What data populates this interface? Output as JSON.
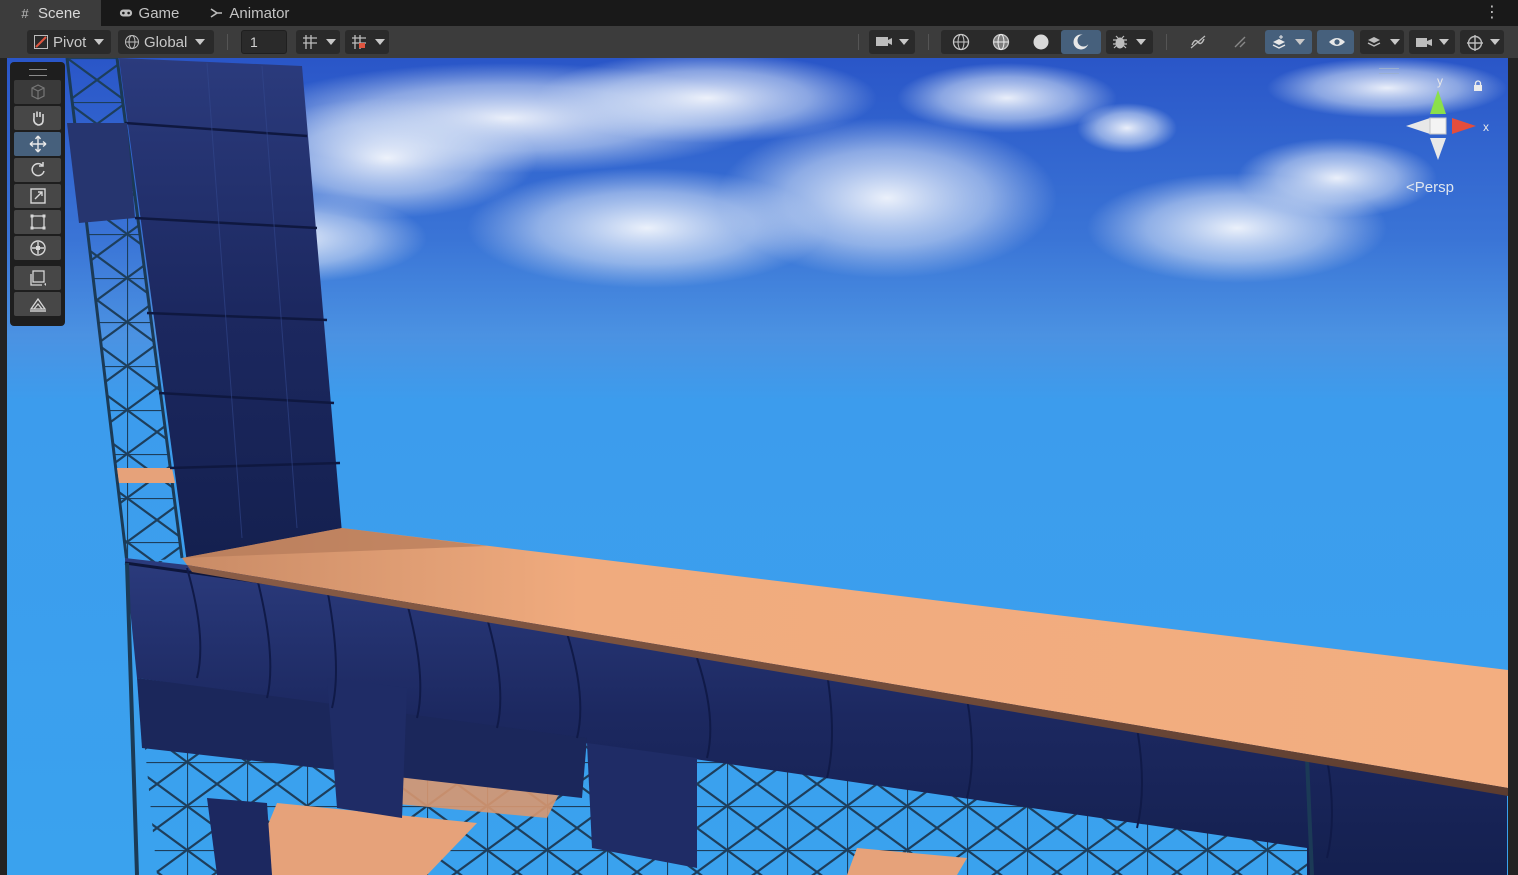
{
  "tabs": [
    {
      "label": "Scene",
      "icon": "grid-icon",
      "active": true
    },
    {
      "label": "Game",
      "icon": "gamepad-icon",
      "active": false
    },
    {
      "label": "Animator",
      "icon": "animator-icon",
      "active": false
    }
  ],
  "toolbar": {
    "pivot_label": "Pivot",
    "global_label": "Global",
    "grid_snap_value": "1",
    "right_icons": [
      "camera-render-mode-icon",
      "wireframe-shading-icon",
      "shaded-wireframe-icon",
      "shaded-icon",
      "lighting-toggle-icon",
      "debug-draw-mode-icon",
      "audio-toggle-icon",
      "effects-toggle-icon",
      "overlay-layers-icon",
      "scene-visibility-icon",
      "layers-icon",
      "camera-settings-icon",
      "gizmos-icon"
    ]
  },
  "tools": [
    "view-cube-icon",
    "hand-tool-icon",
    "move-tool-icon",
    "rotate-tool-icon",
    "scale-tool-icon",
    "rect-tool-icon",
    "transform-tool-icon",
    "custom-tool-icon",
    "terrain-tool-icon"
  ],
  "gizmo": {
    "y_label": "y",
    "x_label": "x",
    "projection_label": "Persp"
  },
  "colors": {
    "accent": "#46607c",
    "sky_top": "#2a56c8",
    "sky_bottom": "#3aa2ee",
    "plank": "#f0a87a",
    "tarp": "#1f2d66",
    "scaffold": "#1a3a55"
  }
}
